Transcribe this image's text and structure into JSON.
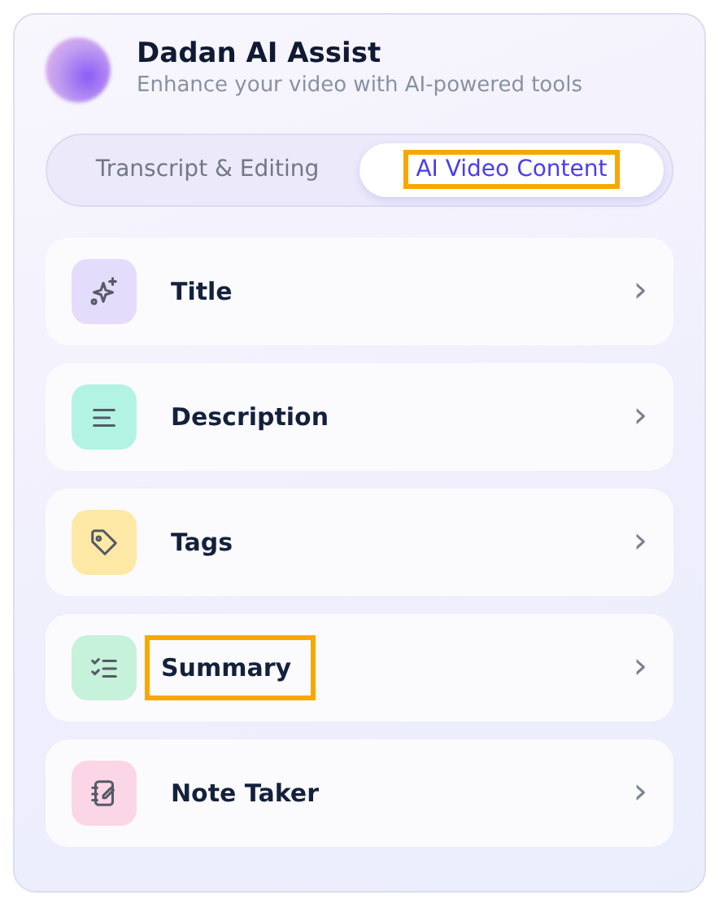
{
  "header": {
    "title": "Dadan AI Assist",
    "subtitle": "Enhance your video with AI-powered tools"
  },
  "tabs": [
    {
      "label": "Transcript & Editing",
      "selected": false,
      "highlighted": false
    },
    {
      "label": "AI Video Content",
      "selected": true,
      "highlighted": true
    }
  ],
  "items": [
    {
      "label": "Title",
      "kind": "sparkle",
      "color": "#e4dcfb",
      "highlighted": false,
      "chevron": "›"
    },
    {
      "label": "Description",
      "kind": "lines",
      "color": "#b3f3e4",
      "highlighted": false,
      "chevron": "›"
    },
    {
      "label": "Tags",
      "kind": "tag",
      "color": "#fde9a5",
      "highlighted": false,
      "chevron": "›"
    },
    {
      "label": "Summary",
      "kind": "checklist",
      "color": "#c6f1da",
      "highlighted": true,
      "chevron": "›"
    },
    {
      "label": "Note Taker",
      "kind": "notebook",
      "color": "#fbd6e7",
      "highlighted": false,
      "chevron": "›"
    }
  ]
}
